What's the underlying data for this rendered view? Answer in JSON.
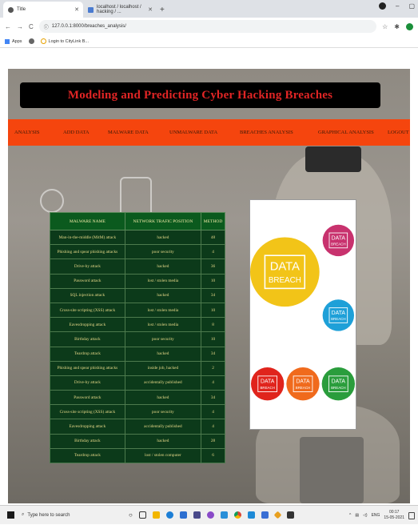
{
  "browser": {
    "tabs": [
      {
        "title": "Title",
        "icon": "globe-icon"
      },
      {
        "title": "localhost / localhost / hacking / ...",
        "icon": "document-icon"
      }
    ],
    "url": "127.0.0.1:8000/breaches_analysis/",
    "bookmarks": [
      "Apps",
      "Login to CityLink B..."
    ]
  },
  "page": {
    "title": "Modeling and Predicting Cyber Hacking Breaches",
    "nav": [
      "ANALYSIS",
      "ADD DATA",
      "MALWARE DATA",
      "UNMALWARE DATA",
      "BREACHES ANALYSIS",
      "GRAPHICAL ANALYSIS",
      "LOGOUT"
    ],
    "table": {
      "headers": [
        "MALWARE NAME",
        "NETWORK TRAFIC POSITION",
        "METHOD"
      ],
      "rows": [
        [
          "Man-in-the-middle (MitM) attack",
          "hacked",
          "48"
        ],
        [
          "Phishing and spear phishing attacks",
          "poor security",
          "4"
        ],
        [
          "Drive-by attack",
          "hacked",
          "36"
        ],
        [
          "Password attack",
          "lost / stolen media",
          "10"
        ],
        [
          "SQL injection attack",
          "hacked",
          "34"
        ],
        [
          "Cross-site scripting (XSS) attack",
          "lost / stolen media",
          "10"
        ],
        [
          "Eavesdropping attack",
          "lost / stolen media",
          "8"
        ],
        [
          "Birthday attack",
          "poor security",
          "10"
        ],
        [
          "Teardrop attack",
          "hacked",
          "34"
        ],
        [
          "Phishing and spear phishing attacks",
          "inside job, hacked",
          "2"
        ],
        [
          "Drive-by attack",
          "accidentally published",
          "4"
        ],
        [
          "Password attack",
          "hacked",
          "34"
        ],
        [
          "Cross-site scripting (XSS) attack",
          "poor security",
          "4"
        ],
        [
          "Eavesdropping attack",
          "accidentally published",
          "4"
        ],
        [
          "Birthday attack",
          "hacked",
          "28"
        ],
        [
          "Teardrop attack",
          "lost / stolen computer",
          "6"
        ]
      ]
    },
    "breach_image": {
      "big_label": [
        "DATA",
        "BREACH"
      ],
      "small_label": [
        "DATA",
        "BREACH"
      ],
      "colors": [
        "#f2c418",
        "#c8326e",
        "#1ea0d8",
        "#e0241c",
        "#f06a1c",
        "#2a9d3c"
      ]
    }
  },
  "taskbar": {
    "search_placeholder": "Type here to search",
    "language": "ENG",
    "time": "00:17",
    "date": "15-05-2021"
  }
}
